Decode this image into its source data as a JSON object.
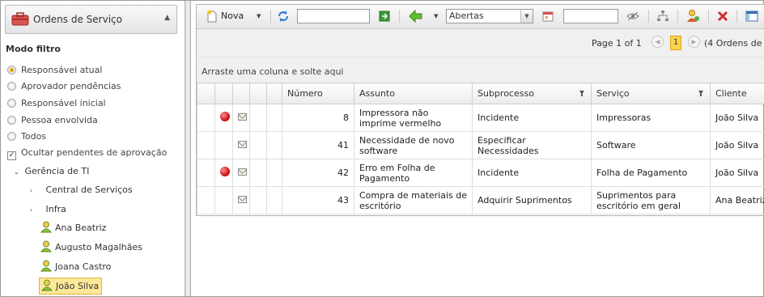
{
  "sidebar": {
    "panel_title": "Ordens de Serviço",
    "filter_title": "Modo filtro",
    "radios": [
      {
        "label": "Responsável atual",
        "selected": true
      },
      {
        "label": "Aprovador pendências",
        "selected": false
      },
      {
        "label": "Responsável inicial",
        "selected": false
      },
      {
        "label": "Pessoa envolvida",
        "selected": false
      },
      {
        "label": "Todos",
        "selected": false
      }
    ],
    "checkbox_label": "Ocultar pendentes de aprovação",
    "checkbox_checked": true,
    "tree": {
      "root": "Gerência de TI",
      "groups": [
        "Central de Serviços",
        "Infra"
      ],
      "users": [
        "Ana Beatriz",
        "Augusto Magalhães",
        "Joana Castro",
        "João Silva"
      ],
      "selected_user": "João Silva"
    }
  },
  "toolbar": {
    "new_label": "Nova",
    "search_value": "",
    "status_select": "Abertas",
    "date_value": ""
  },
  "pager": {
    "page_text": "Page 1 of 1",
    "current_page": "1",
    "count_text": "(4 Ordens de"
  },
  "group_hint": "Arraste uma coluna e solte aqui",
  "table": {
    "columns": [
      "Número",
      "Assunto",
      "Subprocesso",
      "Serviço",
      "Cliente"
    ],
    "rows": [
      {
        "alert": true,
        "numero": "8",
        "assunto": "Impressora não imprime vermelho",
        "subprocesso": "Incidente",
        "servico": "Impressoras",
        "cliente": "João Silva"
      },
      {
        "alert": false,
        "numero": "41",
        "assunto": "Necessidade de novo software",
        "subprocesso": "Especificar Necessidades",
        "servico": "Software",
        "cliente": "João Silva"
      },
      {
        "alert": true,
        "numero": "42",
        "assunto": "Erro em Folha de Pagamento",
        "subprocesso": "Incidente",
        "servico": "Folha de Pagamento",
        "cliente": "João Silva"
      },
      {
        "alert": false,
        "numero": "43",
        "assunto": "Compra de materiais de escritório",
        "subprocesso": "Adquirir Suprimentos",
        "servico": "Suprimentos para escritório em geral",
        "cliente": "Ana Beatriz"
      }
    ]
  },
  "colors": {
    "link": "#3a7fc1",
    "selected_bg": "#fde89a",
    "alert": "#d01515"
  },
  "icons": [
    "briefcase-icon",
    "chevron-up-icon",
    "new-document-icon",
    "refresh-icon",
    "go-icon",
    "back-arrow-icon",
    "calendar-icon",
    "eye-icon",
    "hierarchy-icon",
    "user-assign-icon",
    "delete-icon",
    "panel-icon",
    "user-icon",
    "alert-red-icon",
    "envelope-icon",
    "filter-icon"
  ]
}
